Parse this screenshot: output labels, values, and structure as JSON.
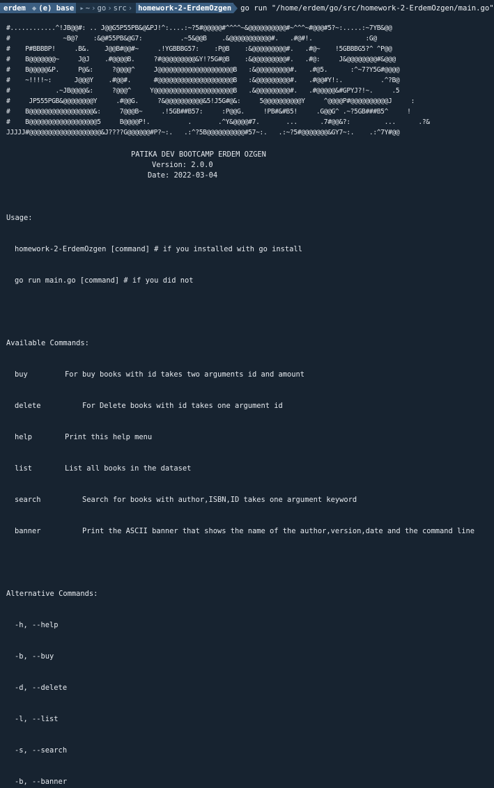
{
  "prompt": {
    "user": "erdem",
    "env": "(e) base",
    "home": "~",
    "path": [
      "go",
      "src"
    ],
    "cwd": "homework-2-ErdemOzgen",
    "command": "go run \"/home/erdem/go/src/homework-2-ErdemOzgen/main.go\""
  },
  "banner": {
    "ascii": [
      "#............^!JB@@#: .. J@@G5P55PB&@&PJ!^:....:~?5#@@@@@#^^^^~&@@@@@@@@@@#~^^^~#@@@#5?~:.....:~7YB&@@",
      "#              ~B@?    :&@#55PB&@G7:          .~5&@@B    .&@@@@@@@@@@@#.   .#@#!.              :G@",
      "#    P#BBBBP!     .B&.    J@@B#@@#~     .!YGBBBG57:    :P@B    :&@@@@@@@@@#.   .#@~    !5GBBBG5?^ ^P@@",
      "#    B@@@@@@@~     J@J    .#@@@@B.     ?#@@@@@@@@@&Y!?5G#@B    :&@@@@@@@@@#.   .#@:     J&@@@@@@@@#&@@@",
      "#    B@@@@@&P.     P@&:     ?@@@@^     J@@@@@@@@@@@@@@@@@@@@B   :&@@@@@@@@@#.   .#@5.      :^~7?Y5G#@@@@",
      "#    ~!!!!~:      J@@@Y    .#@@#.      #@@@@@@@@@@@@@@@@@@@@B   :&@@@@@@@@@#.   .#@@#Y!:.          .^?B@",
      "#            .~JB@@@@&:     ?@@@^     Y@@@@@@@@@@@@@@@@@@@@@B   .&@@@@@@@@@#.   .#@@@@@&#GPYJ?!~.     .5",
      "#     JP555PGB&@@@@@@@@Y     .#@@G.     ?&@@@@@@@@@@&5!J5G#@&:     5@@@@@@@@@@Y     ^@@@@P#@@@@@@@@@@J     :",
      "#    B@@@@@@@@@@@@@@@@@&:     7@@@B~     .!5GB##B57:     :P@@G.     !PB#&#B5!     .G@@G^ .~?5GB###B5^     !",
      "#    B@@@@@@@@@@@@@@@@@@5     B@@@@P!.          .       .^Y&@@@@#7.       ...      .7#@@&?:         ...      .?&",
      "JJJJJ#@@@@@@@@@@@@@@@@@@@&J????G@@@@@@#P?~:.   .:^?5B@@@@@@@@@@#57~:.   .:~?5#@@@@@@@&GY7~:.    .:^7Y#@@"
    ],
    "title": "PATIKA DEV BOOTCAMP ERDEM OZGEN",
    "version": "Version: 2.0.0",
    "date": "Date: 2022-03-04"
  },
  "usage": {
    "heading": "Usage:",
    "lines": [
      "homework-2-ErdemOzgen [command] # if you installed with go install",
      "go run main.go [command] # if you did not"
    ]
  },
  "available": {
    "heading": "Available Commands:",
    "commands": [
      {
        "name": "buy",
        "desc": "For buy books with id takes two arguments id and amount"
      },
      {
        "name": "delete",
        "desc": "    For Delete books with id takes one argument id"
      },
      {
        "name": "help",
        "desc": "Print this help menu"
      },
      {
        "name": "list",
        "desc": "List all books in the dataset"
      },
      {
        "name": "search",
        "desc": "    Search for books with author,ISBN,ID takes one argument keyword"
      },
      {
        "name": "banner",
        "desc": "    Print the ASCII banner that shows the name of the author,version,date and the command line"
      }
    ]
  },
  "alternative": {
    "heading": "Alternative Commands:",
    "lines": [
      "-h, --help",
      "-b, --buy",
      "-d, --delete",
      "-l, --list",
      "-s, --search",
      "-b, --banner"
    ]
  }
}
